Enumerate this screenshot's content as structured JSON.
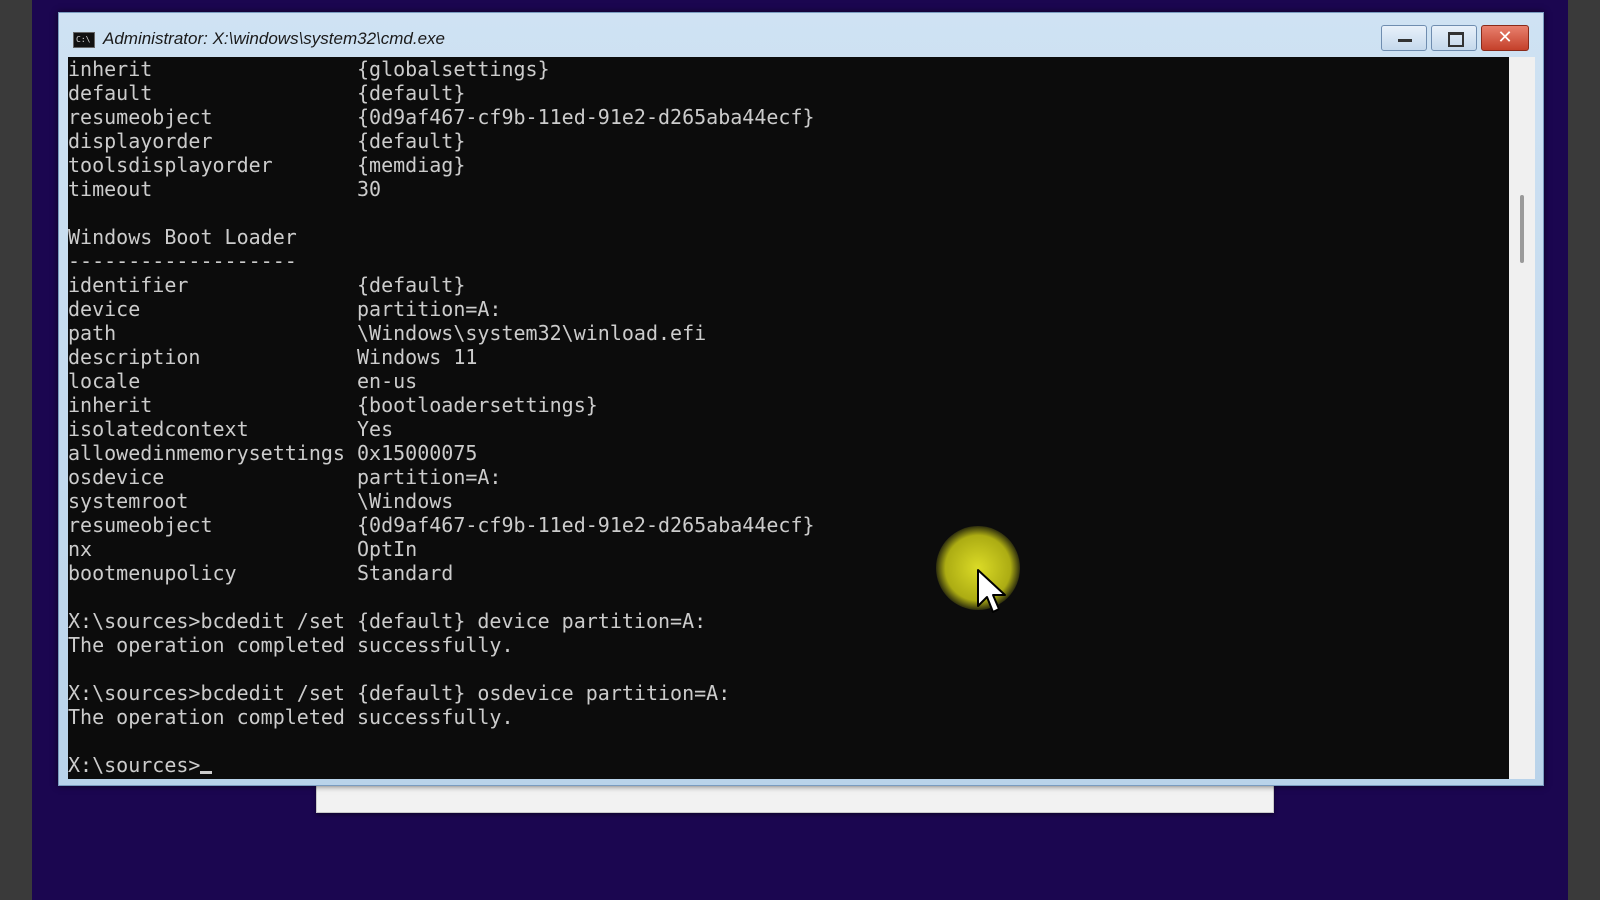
{
  "window": {
    "title": "Administrator: X:\\windows\\system32\\cmd.exe",
    "icon": "cmd-icon",
    "icon_text": "C:\\",
    "controls": {
      "minimize": "minimize-icon",
      "maximize": "maximize-icon",
      "close_label": "✕"
    }
  },
  "console": {
    "lines": [
      "inherit                 {globalsettings}",
      "default                 {default}",
      "resumeobject            {0d9af467-cf9b-11ed-91e2-d265aba44ecf}",
      "displayorder            {default}",
      "toolsdisplayorder       {memdiag}",
      "timeout                 30",
      "",
      "Windows Boot Loader",
      "-------------------",
      "identifier              {default}",
      "device                  partition=A:",
      "path                    \\Windows\\system32\\winload.efi",
      "description             Windows 11",
      "locale                  en-us",
      "inherit                 {bootloadersettings}",
      "isolatedcontext         Yes",
      "allowedinmemorysettings 0x15000075",
      "osdevice                partition=A:",
      "systemroot              \\Windows",
      "resumeobject            {0d9af467-cf9b-11ed-91e2-d265aba44ecf}",
      "nx                      OptIn",
      "bootmenupolicy          Standard",
      "",
      "X:\\sources>bcdedit /set {default} device partition=A:",
      "The operation completed successfully.",
      "",
      "X:\\sources>bcdedit /set {default} osdevice partition=A:",
      "The operation completed successfully.",
      ""
    ],
    "prompt": "X:\\sources>"
  },
  "colors": {
    "console_background": "#0c0c0c",
    "console_text": "#cccccc",
    "desktop_background": "#1b0650",
    "cursor_highlight": "#d4d420"
  }
}
